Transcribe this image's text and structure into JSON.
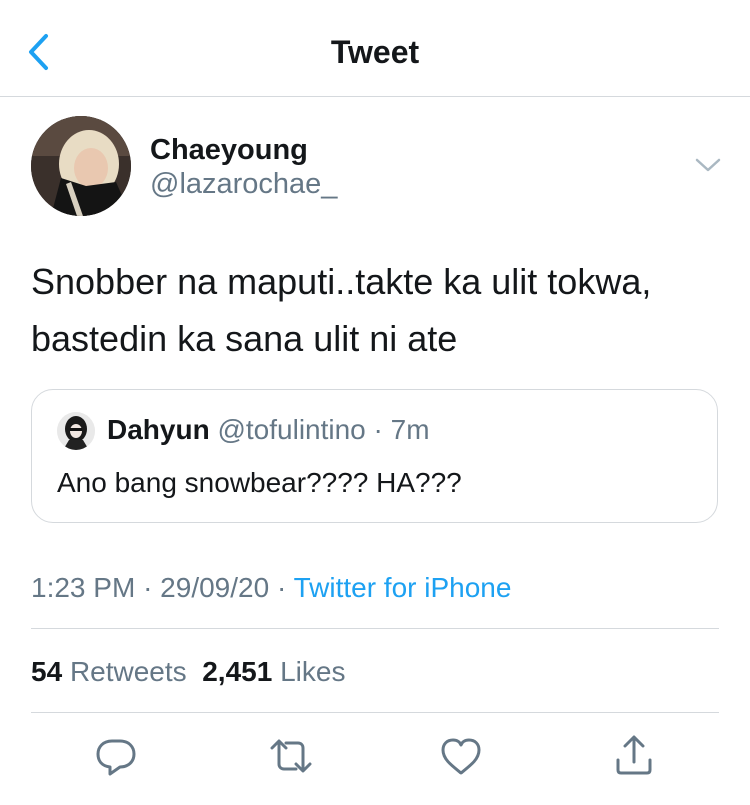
{
  "header": {
    "title": "Tweet",
    "back_icon": "chevron-left-icon"
  },
  "author": {
    "display_name": "Chaeyoung",
    "handle": "@lazarochae_"
  },
  "tweet": {
    "line1": "Snobber na maputi..takte ka ulit tokwa,",
    "line2": "bastedin ka sana ulit ni ate"
  },
  "quoted": {
    "display_name": "Dahyun",
    "handle": "@tofulintino",
    "separator": "·",
    "time": "7m",
    "text": "Ano bang snowbear???? HA???"
  },
  "meta": {
    "time": "1:23 PM",
    "separator": "·",
    "date": "29/09/20",
    "source": "Twitter for iPhone"
  },
  "stats": {
    "retweets_count": "54",
    "retweets_label": "Retweets",
    "likes_count": "2,451",
    "likes_label": "Likes"
  },
  "actions": [
    "reply-icon",
    "retweet-icon",
    "like-icon",
    "share-icon"
  ],
  "colors": {
    "accent": "#1da1f2",
    "secondary_text": "#657786",
    "divider": "#d5d9dd"
  }
}
